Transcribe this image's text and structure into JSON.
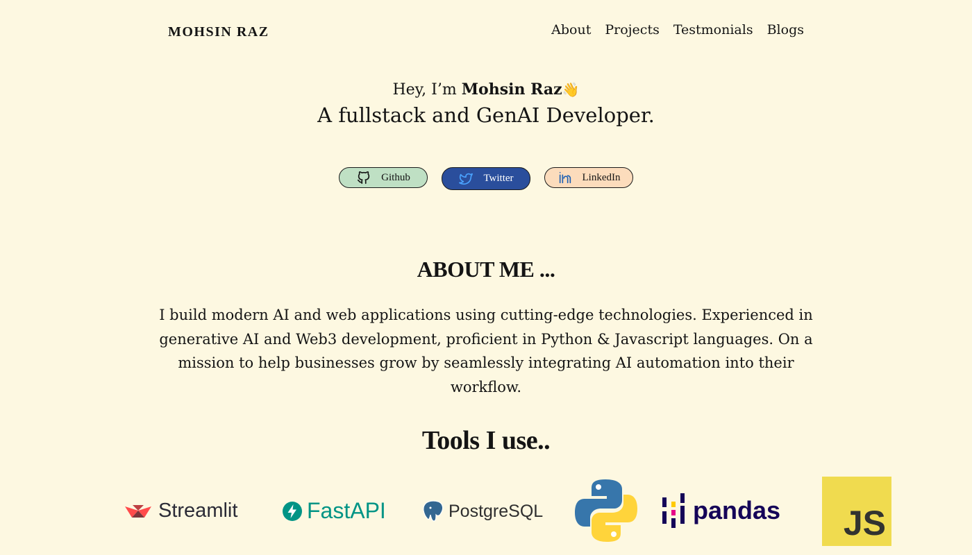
{
  "nav": {
    "brand": "MOHSIN RAZ",
    "links": [
      "About",
      "Projects",
      "Testmonials",
      "Blogs"
    ]
  },
  "hero": {
    "greeting_prefix": "Hey, I’m",
    "name": "Mohsin Raz",
    "wave": "👋",
    "tagline": "A fullstack and GenAI Developer."
  },
  "socials": [
    {
      "label": "Github",
      "icon": "github-icon",
      "color": "#bfe0c4"
    },
    {
      "label": "Twitter",
      "icon": "twitter-icon",
      "color": "#2a4e9c"
    },
    {
      "label": "LinkedIn",
      "icon": "linkedin-icon",
      "color": "#fcdcbc"
    }
  ],
  "about": {
    "heading": "ABOUT ME ...",
    "text": "I build modern AI and web applications using cutting-edge technologies. Experienced in generative AI and Web3 development, proficient in Python & Javascript languages. On a mission to help businesses grow by seamlessly integrating AI automation into their workflow."
  },
  "tools": {
    "heading": "Tools I use..",
    "items": [
      {
        "name": "Streamlit",
        "icon": "streamlit-logo",
        "color": "#ff4b4b"
      },
      {
        "name": "FastAPI",
        "icon": "fastapi-logo",
        "color": "#009485"
      },
      {
        "name": "PostgreSQL",
        "icon": "postgresql-logo",
        "color": "#336791"
      },
      {
        "name": "Python",
        "icon": "python-logo",
        "color": "#3776ab"
      },
      {
        "name": "pandas",
        "icon": "pandas-logo",
        "color": "#150458"
      },
      {
        "name": "JS",
        "icon": "javascript-logo",
        "color": "#f0db4f"
      }
    ]
  },
  "theme": {
    "background": "#fdf8e1"
  }
}
